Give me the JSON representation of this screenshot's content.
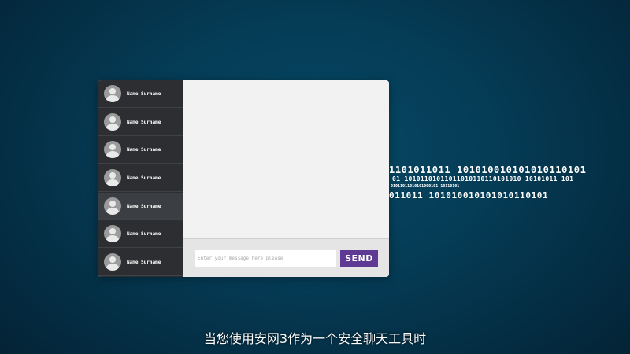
{
  "sidebar": {
    "contacts": [
      {
        "name": "Name Surname"
      },
      {
        "name": "Name Surname"
      },
      {
        "name": "Name Surname"
      },
      {
        "name": "Name Surname"
      },
      {
        "name": "Name Surname"
      },
      {
        "name": "Name Surname"
      },
      {
        "name": "Name Surname"
      }
    ],
    "active_index": 4,
    "avatar_icon": "user-avatar-icon"
  },
  "compose": {
    "placeholder": "Enter your message here please",
    "send_label": "SEND"
  },
  "binary_text": [
    "1101011011  101010010101010110101",
    "01  10101101011011010110110101010  10101011  101",
    "01011011010101000101  10110101",
    "011011  101010010101010110101"
  ],
  "subtitle": "当您使用安网3作为一个安全聊天工具时",
  "colors": {
    "send_button": "#5f3a94",
    "sidebar_bg": "#2c2e31",
    "sidebar_active": "#3b3e42",
    "background": "#053b55"
  }
}
